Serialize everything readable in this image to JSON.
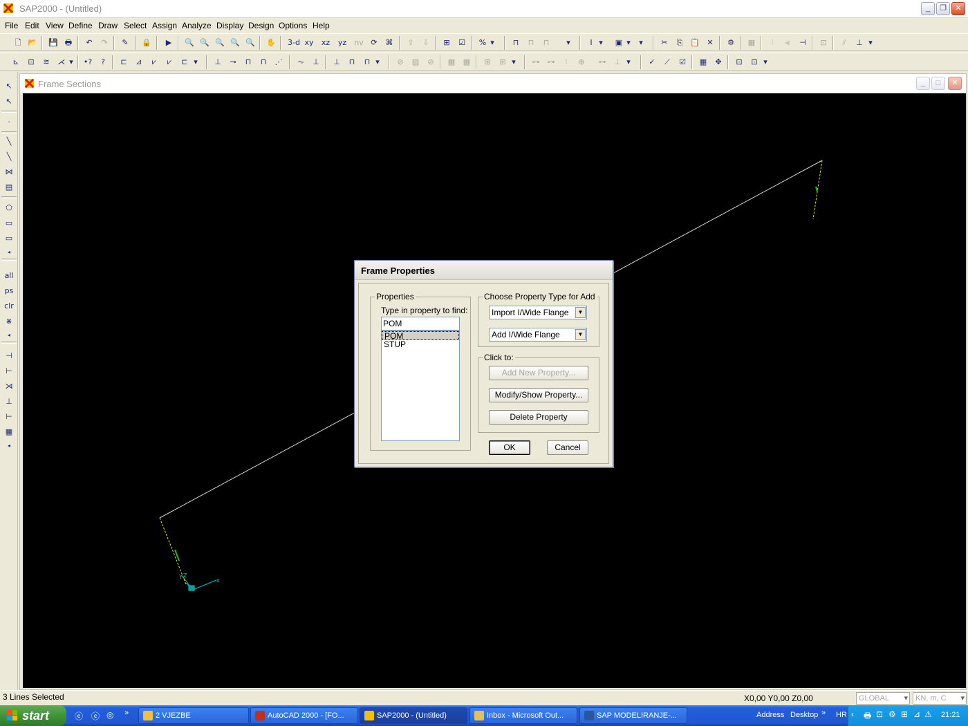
{
  "app": {
    "title": "SAP2000 - (Untitled)",
    "menu": [
      "File",
      "Edit",
      "View",
      "Define",
      "Draw",
      "Select",
      "Assign",
      "Analyze",
      "Display",
      "Design",
      "Options",
      "Help"
    ]
  },
  "toolbar": {
    "view_3d": "3-d",
    "view_xy": "xy",
    "view_xz": "xz",
    "view_yz": "yz",
    "view_nv": "nv"
  },
  "left_toolbar": {
    "sel_all": "all",
    "sel_ps": "ps",
    "sel_clr": "clr"
  },
  "child_window": {
    "title": "Frame Sections"
  },
  "dialog": {
    "title": "Frame Properties",
    "properties_group": "Properties",
    "find_label": "Type in property to find:",
    "find_value": "POM",
    "items": [
      "POM",
      "STUP"
    ],
    "selected_item": "POM",
    "choose_group": "Choose Property Type for Add",
    "import_type": "Import I/Wide Flange",
    "add_type": "Add I/Wide Flange",
    "click_group": "Click to:",
    "add_new": "Add New Property...",
    "modify_show": "Modify/Show Property...",
    "delete": "Delete Property",
    "ok": "OK",
    "cancel": "Cancel"
  },
  "status": {
    "selection": "3 Lines Selected",
    "coords": "X0,00  Y0,00  Z0,00",
    "coord_system": "GLOBAL",
    "units": "KN, m, C"
  },
  "taskbar": {
    "start": "start",
    "buttons": [
      "2 VJEZBE",
      "AutoCAD 2000 - [FO...",
      "SAP2000 - (Untitled)",
      "Inbox - Microsoft Out...",
      "SAP  MODELIRANJE-..."
    ],
    "address": "Address",
    "desktop": "Desktop",
    "lang": "HR",
    "time": "21:21"
  },
  "colors": {
    "canvas_bg": "#000000",
    "frame_line": "#d8d8d8",
    "column_line": "#e6e600",
    "axis": "#00c8c8"
  }
}
